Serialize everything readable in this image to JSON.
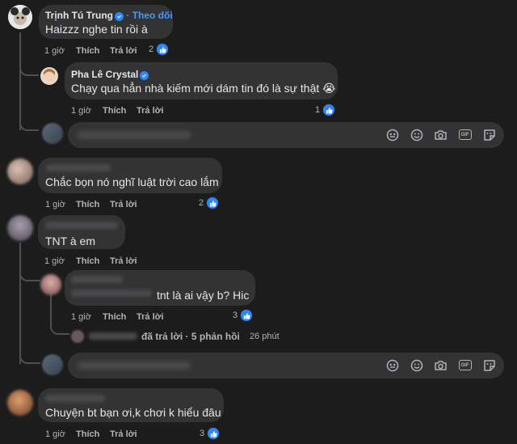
{
  "ui": {
    "like_label": "Thích",
    "reply_label": "Trả lời"
  },
  "comments": [
    {
      "author": "Trịnh Tú Trung",
      "follow": "· Theo dõi",
      "text": "Haizzz nghe tin rồi à",
      "time": "1 giờ",
      "likes": "2",
      "reply": {
        "author": "Pha Lê Crystal",
        "text": "Chạy qua hẳn nhà kiếm mới dám tin đó là sự thật 😭",
        "time": "1 giờ",
        "likes": "1"
      }
    },
    {
      "text": "Chắc bọn nó nghĩ luật trời cao lắm",
      "time": "1 giờ",
      "likes": "2"
    },
    {
      "text": "TNT à em",
      "time": "1 giờ",
      "reply": {
        "text": "tnt là ai vậy b? Hic",
        "time": "1 giờ",
        "likes": "3"
      },
      "more_replies": "đã trả lời · 5 phản hồi",
      "more_time": "26 phút"
    },
    {
      "text": "Chuyện bt bạn ơi,k chơi k hiểu đâu",
      "time": "1 giờ",
      "likes": "3"
    }
  ],
  "icons": [
    "sticker-smile-icon",
    "emoji-icon",
    "camera-icon",
    "gif-icon",
    "sticker-icon",
    "like-icon",
    "verified-icon"
  ],
  "colors": {
    "background": "#1c1c1d",
    "bubble": "#333334",
    "accent": "#2d86ff",
    "link": "#4599ff",
    "muted": "#b0b3b8"
  }
}
